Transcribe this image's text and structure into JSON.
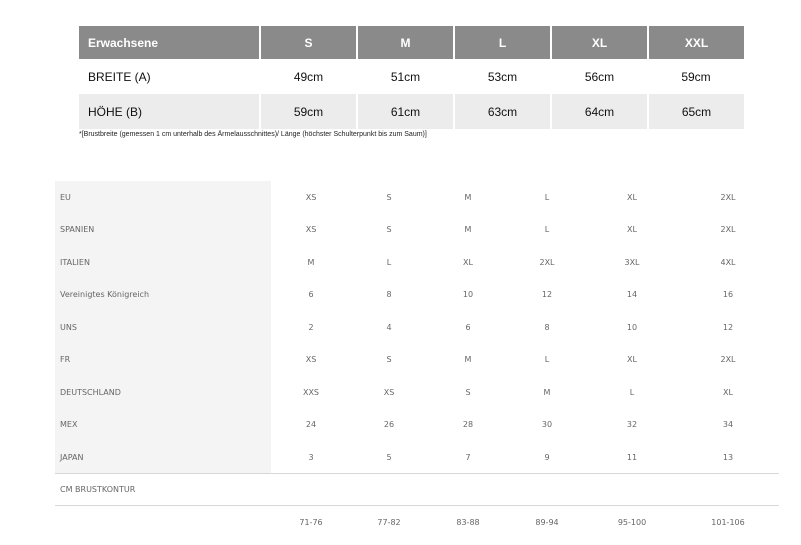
{
  "top_table": {
    "header": [
      "Erwachsene",
      "S",
      "M",
      "L",
      "XL",
      "XXL"
    ],
    "rows": [
      {
        "label": "BREITE (A)",
        "values": [
          "49cm",
          "51cm",
          "53cm",
          "56cm",
          "59cm"
        ]
      },
      {
        "label": "HÖHE (B)",
        "values": [
          "59cm",
          "61cm",
          "63cm",
          "64cm",
          "65cm"
        ]
      }
    ],
    "header_color": "#8a8a8a",
    "shade_color": "#ececec"
  },
  "footnote": "*[Brustbreite (gemessen 1 cm unterhalb des Ärmelausschnittes)/ Länge (höchster Schulterpunkt bis zum Saum)]",
  "conversion": {
    "rows": [
      {
        "label": "EU",
        "values": [
          "XS",
          "S",
          "M",
          "L",
          "XL",
          "2XL"
        ]
      },
      {
        "label": "SPANIEN",
        "values": [
          "XS",
          "S",
          "M",
          "L",
          "XL",
          "2XL"
        ]
      },
      {
        "label": "ITALIEN",
        "values": [
          "M",
          "L",
          "XL",
          "2XL",
          "3XL",
          "4XL"
        ]
      },
      {
        "label": "Vereinigtes Königreich",
        "values": [
          "6",
          "8",
          "10",
          "12",
          "14",
          "16"
        ]
      },
      {
        "label": "UNS",
        "values": [
          "2",
          "4",
          "6",
          "8",
          "10",
          "12"
        ]
      },
      {
        "label": "FR",
        "values": [
          "XS",
          "S",
          "M",
          "L",
          "XL",
          "2XL"
        ]
      },
      {
        "label": "DEUTSCHLAND",
        "values": [
          "XXS",
          "XS",
          "S",
          "M",
          "L",
          "XL"
        ]
      },
      {
        "label": "MEX",
        "values": [
          "24",
          "26",
          "28",
          "30",
          "32",
          "34"
        ]
      },
      {
        "label": "JAPAN",
        "values": [
          "3",
          "5",
          "7",
          "9",
          "11",
          "13"
        ]
      }
    ],
    "cm_label": "CM BRUSTKONTUR",
    "cm_values": [
      "71-76",
      "77-82",
      "83-88",
      "89-94",
      "95-100",
      "101-106"
    ]
  }
}
